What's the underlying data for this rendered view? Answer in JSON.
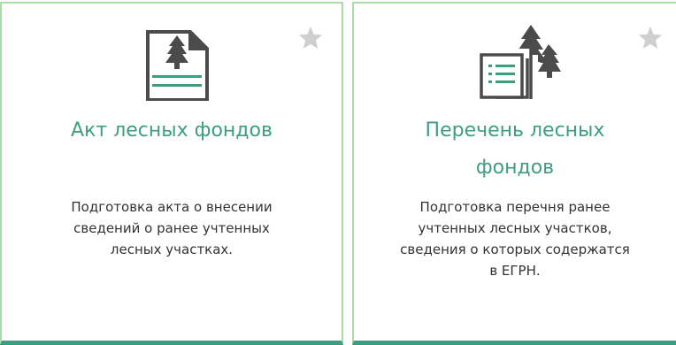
{
  "colors": {
    "accent": "#3e9e82",
    "card_border": "#a9dea9",
    "icon_gray": "#4b4b4b",
    "star_gray": "#cfcfcf",
    "text": "#333333"
  },
  "cards": [
    {
      "icon": "forest-document-icon",
      "title": "Акт лесных фондов",
      "description_lines": [
        "Подготовка акта о внесении",
        "сведений о ранее учтенных",
        "лесных участках."
      ],
      "favorite_icon": "star-icon"
    },
    {
      "icon": "forest-list-icon",
      "title_lines": [
        "Перечень лесных",
        "фондов"
      ],
      "description_lines": [
        "Подготовка перечня ранее",
        "учтенных лесных участков,",
        "сведения о которых содержатся",
        "в ЕГРН."
      ],
      "favorite_icon": "star-icon"
    }
  ]
}
